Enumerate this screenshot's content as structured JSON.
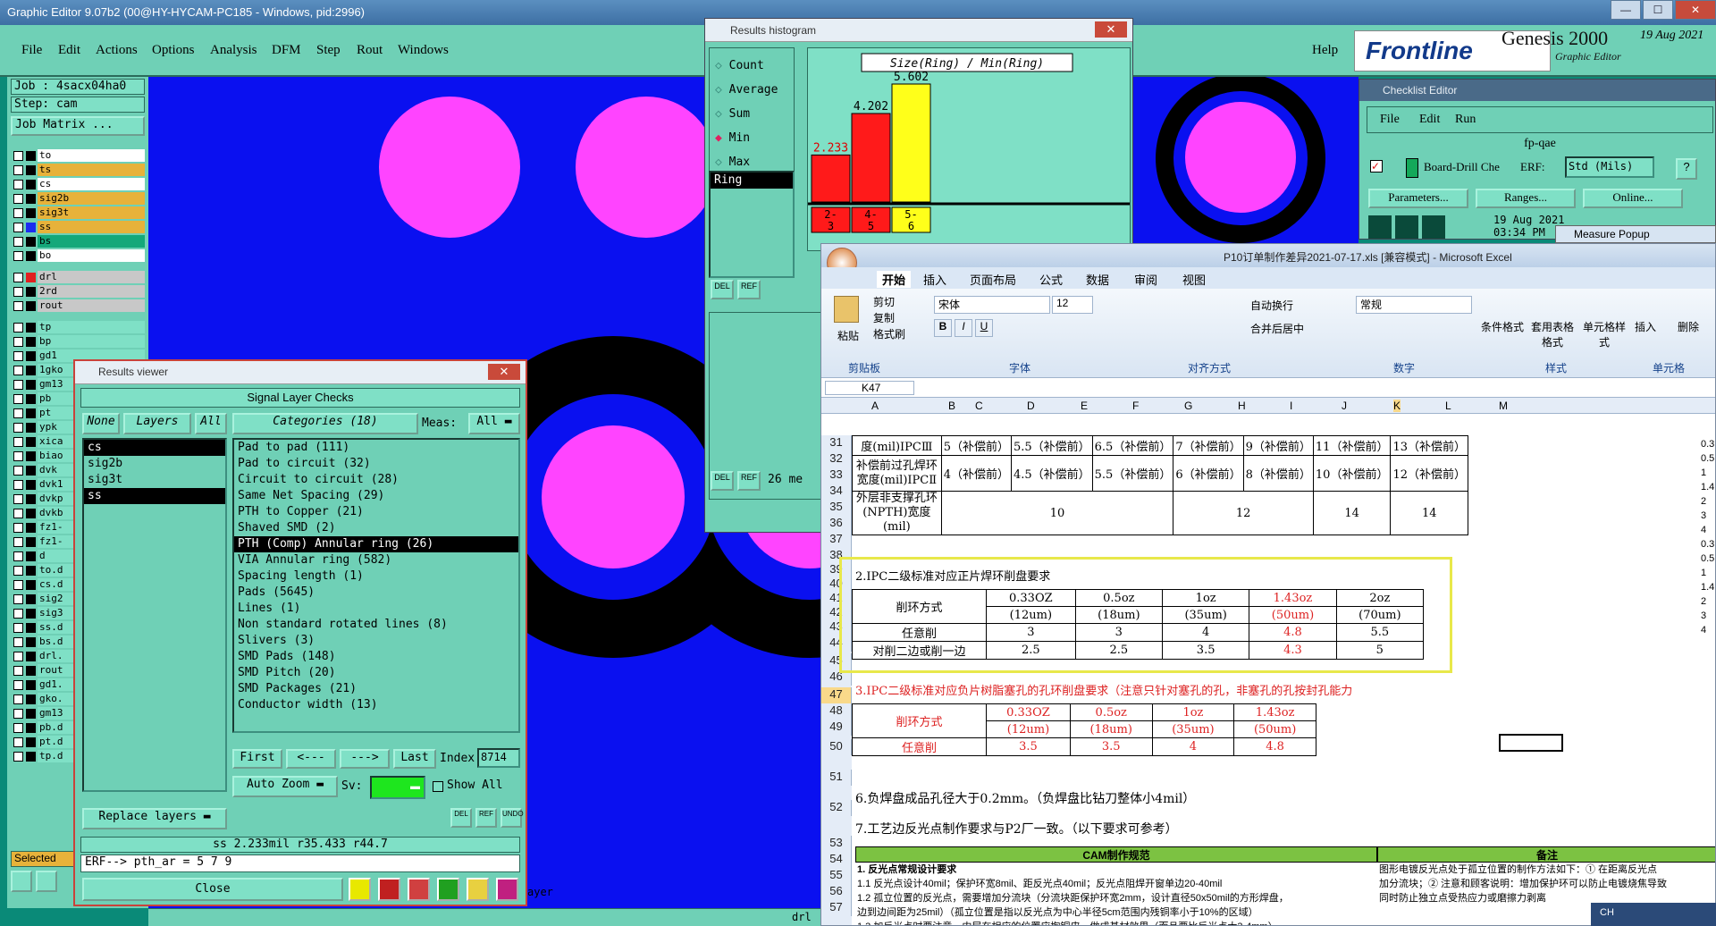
{
  "app": {
    "title": "Graphic Editor 9.07b2 (00@HY-HYCAM-PC185 - Windows, pid:2996)",
    "min": "—",
    "max": "☐",
    "close": "✕"
  },
  "menu": [
    "File",
    "Edit",
    "Actions",
    "Options",
    "Analysis",
    "DFM",
    "Step",
    "Rout",
    "Windows"
  ],
  "help": "Help",
  "brand": {
    "frontline": "Frontline",
    "genesis": "Genesis 2000",
    "genesis_sub": "Graphic Editor",
    "date": "19 Aug 2021"
  },
  "left": {
    "job": "Job : 4sacx04ha0",
    "step": "Step: cam",
    "job_matrix": "Job Matrix ...",
    "selected": "Selected",
    "layers": [
      {
        "name": "to",
        "color": "#ffffff",
        "swatch": "#000000"
      },
      {
        "name": "ts",
        "color": "#e7b23a",
        "swatch": "#000000"
      },
      {
        "name": "cs",
        "color": "#ffffff",
        "swatch": "#000000"
      },
      {
        "name": "sig2b",
        "color": "#e7b23a",
        "swatch": "#000000"
      },
      {
        "name": "sig3t",
        "color": "#e7b23a",
        "swatch": "#000000"
      },
      {
        "name": "ss",
        "color": "#e7b23a",
        "swatch": "#1b2cf0"
      },
      {
        "name": "bs",
        "color": "#14a87a",
        "swatch": "#000000"
      },
      {
        "name": "bo",
        "color": "#ffffff",
        "swatch": "#000000"
      },
      {
        "name": "drl",
        "color": "#c8c8c8",
        "swatch": "#e02020"
      },
      {
        "name": "2rd",
        "color": "#c8c8c8",
        "swatch": "#000000"
      },
      {
        "name": "rout",
        "color": "#c8c8c8",
        "swatch": "#000000"
      },
      {
        "name": "tp",
        "color": "#7fe0c6",
        "swatch": "#000000"
      },
      {
        "name": "bp",
        "color": "#7fe0c6",
        "swatch": "#000000"
      },
      {
        "name": "gd1",
        "color": "#7fe0c6",
        "swatch": "#000000"
      },
      {
        "name": "1gko",
        "color": "#7fe0c6",
        "swatch": "#000000"
      },
      {
        "name": "gm13",
        "color": "#7fe0c6",
        "swatch": "#000000"
      },
      {
        "name": "pb",
        "color": "#7fe0c6",
        "swatch": "#000000"
      },
      {
        "name": "pt",
        "color": "#7fe0c6",
        "swatch": "#000000"
      },
      {
        "name": "ypk",
        "color": "#7fe0c6",
        "swatch": "#000000"
      },
      {
        "name": "xica",
        "color": "#7fe0c6",
        "swatch": "#000000"
      },
      {
        "name": "biao",
        "color": "#7fe0c6",
        "swatch": "#000000"
      },
      {
        "name": "dvk",
        "color": "#7fe0c6",
        "swatch": "#000000"
      },
      {
        "name": "dvk1",
        "color": "#7fe0c6",
        "swatch": "#000000"
      },
      {
        "name": "dvkp",
        "color": "#7fe0c6",
        "swatch": "#000000"
      },
      {
        "name": "dvkb",
        "color": "#7fe0c6",
        "swatch": "#000000"
      },
      {
        "name": "fz1-",
        "color": "#7fe0c6",
        "swatch": "#000000"
      },
      {
        "name": "fz1-",
        "color": "#7fe0c6",
        "swatch": "#000000"
      },
      {
        "name": "d",
        "color": "#7fe0c6",
        "swatch": "#000000"
      },
      {
        "name": "to.d",
        "color": "#7fe0c6",
        "swatch": "#000000"
      },
      {
        "name": "cs.d",
        "color": "#7fe0c6",
        "swatch": "#000000"
      },
      {
        "name": "sig2",
        "color": "#7fe0c6",
        "swatch": "#000000"
      },
      {
        "name": "sig3",
        "color": "#7fe0c6",
        "swatch": "#000000"
      },
      {
        "name": "ss.d",
        "color": "#7fe0c6",
        "swatch": "#000000"
      },
      {
        "name": "bs.d",
        "color": "#7fe0c6",
        "swatch": "#000000"
      },
      {
        "name": "drl.",
        "color": "#7fe0c6",
        "swatch": "#000000"
      },
      {
        "name": "rout",
        "color": "#7fe0c6",
        "swatch": "#000000"
      },
      {
        "name": "gd1.",
        "color": "#7fe0c6",
        "swatch": "#000000"
      },
      {
        "name": "gko.",
        "color": "#7fe0c6",
        "swatch": "#000000"
      },
      {
        "name": "gm13",
        "color": "#7fe0c6",
        "swatch": "#000000"
      },
      {
        "name": "pb.d",
        "color": "#7fe0c6",
        "swatch": "#000000"
      },
      {
        "name": "pt.d",
        "color": "#7fe0c6",
        "swatch": "#000000"
      },
      {
        "name": "tp.d",
        "color": "#7fe0c6",
        "swatch": "#000000"
      }
    ]
  },
  "results_viewer": {
    "title": "Results viewer",
    "header": "Signal Layer Checks",
    "none": "None",
    "layers_btn": "Layers",
    "all": "All",
    "categories_btn": "Categories (18)",
    "meas_label": "Meas:",
    "meas_value": "All",
    "layers": [
      "cs",
      "sig2b",
      "sig3t",
      "ss"
    ],
    "selected_layers": [
      "cs",
      "ss"
    ],
    "categories": [
      "Pad to pad (111)",
      "Pad to circuit (32)",
      "Circuit to circuit (28)",
      "Same Net Spacing (29)",
      "PTH to Copper (21)",
      "Shaved SMD (2)",
      "PTH (Comp) Annular ring (26)",
      "VIA Annular ring (582)",
      "Spacing length (1)",
      "Pads (5645)",
      "Lines (1)",
      "Non standard rotated lines (8)",
      "Slivers (3)",
      "SMD Pads (148)",
      "SMD Pitch (20)",
      "SMD Packages (21)",
      "Conductor width (13)"
    ],
    "selected_category": "PTH (Comp) Annular ring (26)",
    "first": "First",
    "prev": "<---",
    "next": "--->",
    "last": "Last",
    "index_label": "Index:",
    "index_value": "8714",
    "auto_zoom": "Auto Zoom",
    "sv_label": "Sv:",
    "show_all": "Show All",
    "replace_layers": "Replace layers",
    "status": "ss 2.233mil   r35.433   r44.7",
    "erf": "ERF--> pth_ar = 5 7 9",
    "close": "Close",
    "del": "DEL",
    "ref": "REF",
    "undo": "UNDO"
  },
  "histogram": {
    "title": "Results histogram",
    "options": [
      "Count",
      "Average",
      "Sum",
      "Min",
      "Max"
    ],
    "selected_option": "Min",
    "list_item": "Ring",
    "count_text": "26 me",
    "del": "DEL",
    "ref": "REF"
  },
  "chart_data": {
    "type": "bar",
    "title": "Size(Ring) / Min(Ring)",
    "categories": [
      "2-3",
      "4-5",
      "5-6"
    ],
    "values": [
      2.233,
      4.202,
      5.602
    ],
    "colors": [
      "#ff1a1a",
      "#ff1a1a",
      "#ffff1a"
    ],
    "ylim": [
      0,
      5.602
    ]
  },
  "checklist": {
    "title": "Checklist Editor",
    "menu": [
      "File",
      "Edit",
      "Run"
    ],
    "name": "fp-qae",
    "item": "Board-Drill Che",
    "erf": "ERF:",
    "units": "Std (Mils)",
    "q": "?",
    "buttons": [
      "Parameters...",
      "Ranges...",
      "Online..."
    ],
    "date": "19 Aug 2021",
    "time": "03:34 PM",
    "measure_popup": "Measure Popup"
  },
  "excel": {
    "title": "P10订单制作差异2021-07-17.xls  [兼容模式] - Microsoft Excel",
    "tabs": [
      "开始",
      "插入",
      "页面布局",
      "公式",
      "数据",
      "审阅",
      "视图"
    ],
    "font": "宋体",
    "size": "12",
    "format": "常规",
    "groups": [
      "剪贴板",
      "字体",
      "对齐方式",
      "数字",
      "样式",
      "单元格"
    ],
    "paste": "粘贴",
    "cut": "剪切",
    "copy": "复制",
    "painter": "格式刷",
    "wrap": "自动换行",
    "merge": "合并后居中",
    "cond": "条件格式",
    "tablefmt": "套用表格格式",
    "cellstyle": "单元格样式",
    "insert": "插入",
    "delete": "删除",
    "namebox": "K47",
    "cols": [
      "A",
      "B",
      "C",
      "D",
      "E",
      "F",
      "G",
      "H",
      "I",
      "J",
      "K",
      "L",
      "M"
    ],
    "rows": [
      "31",
      "32",
      "33",
      "34",
      "35",
      "36",
      "37",
      "38",
      "39",
      "40",
      "41",
      "42",
      "43",
      "44",
      "45",
      "46",
      "47",
      "48",
      "49",
      "50",
      "51",
      "52",
      "53",
      "54",
      "55",
      "56",
      "57"
    ],
    "r31": [
      "度(mil)IPCⅢ",
      "5（补偿前）",
      "5.5（补偿前）",
      "6.5（补偿前）",
      "7（补偿前）",
      "9（补偿前）",
      "11（补偿前）",
      "13（补偿前）"
    ],
    "r33": [
      "补偿前过孔焊环宽度(mil)IPCⅡ",
      "4（补偿前）",
      "4.5（补偿前）",
      "5.5（补偿前）",
      "6（补偿前）",
      "8（补偿前）",
      "10（补偿前）",
      "12（补偿前）"
    ],
    "r35": [
      "外层非支撑孔环(NPTH)宽度(mil)",
      "10",
      "12",
      "14",
      "14"
    ],
    "sec2": "2.IPC二级标准对应正片焊环削盘要求",
    "t2_head": [
      "削环方式",
      "0.33OZ",
      "0.5oz",
      "1oz",
      "1.43oz",
      "2oz"
    ],
    "t2_sub": [
      "(12um)",
      "(18um)",
      "(35um)",
      "(50um)",
      "(70um)"
    ],
    "t2_r1": [
      "任意削",
      "3",
      "3",
      "4",
      "4.8",
      "5.5"
    ],
    "t2_r2": [
      "对削二边或削一边",
      "2.5",
      "2.5",
      "3.5",
      "4.3",
      "5"
    ],
    "sec3": "3.IPC二级标准对应负片树脂塞孔的孔环削盘要求（注意只针对塞孔的孔，非塞孔的孔按封孔能力",
    "t3_head": [
      "削环方式",
      "0.33OZ",
      "0.5oz",
      "1oz",
      "1.43oz"
    ],
    "t3_sub": [
      "(12um)",
      "(18um)",
      "(35um)",
      "(50um)"
    ],
    "t3_r1": [
      "任意削",
      "3.5",
      "3.5",
      "4",
      "4.8"
    ],
    "line6": "6.负焊盘成品孔径大于0.2mm。（负焊盘比钻刀整体小4mil）",
    "line7": "7.工艺边反光点制作要求与P2厂一致。（以下要求可参考）",
    "cam_head": "CAM制作规范",
    "note_head": "备注",
    "cam_lines": [
      "1. 反光点常规设计要求",
      "1.1 反光点设计40mil；保护环宽8mil、距反光点40mil；反光点阻焊开窗单边20-40mil",
      "1.2 孤立位置的反光点，需要增加分流块（分流块距保护环宽2mm，设计直径50x50mil的方形焊盘，",
      "边到边间距为25mil）（孤立位置是指以反光点为中心半径5cm范围内残铜率小于10%的区域）",
      "1.3 加反光点时要注意，内层在相应的位置应掏铜皮，做成基材效果（而且要比反光点大3-4mm），",
      "特别留意当内层是负片层时，需要加隔离盘。客户有要求除外",
      "1.4 下列情况可以不考虑设计保护环：① 工艺流程设计为塞孔流程；② 工艺流程设计为图形电"
    ],
    "note_lines": [
      "图形电镀反光点处于孤立位置的制作方法如下：① 在距离反光点",
      "加分流块；② 注意和顾客说明：增加保护环可以防止电镀烧焦导致",
      "同时防止独立点受热应力或磨擦力剥离"
    ],
    "right_vals": [
      "0.3",
      "0.5",
      "1",
      "1.4",
      "2",
      "3",
      "4",
      "0.3",
      "0.5",
      "1",
      "1.4",
      "2",
      "3",
      "4"
    ]
  },
  "statusbar": {
    "layer_word": "ayer",
    "drl": "drl",
    "ime": "CH"
  }
}
